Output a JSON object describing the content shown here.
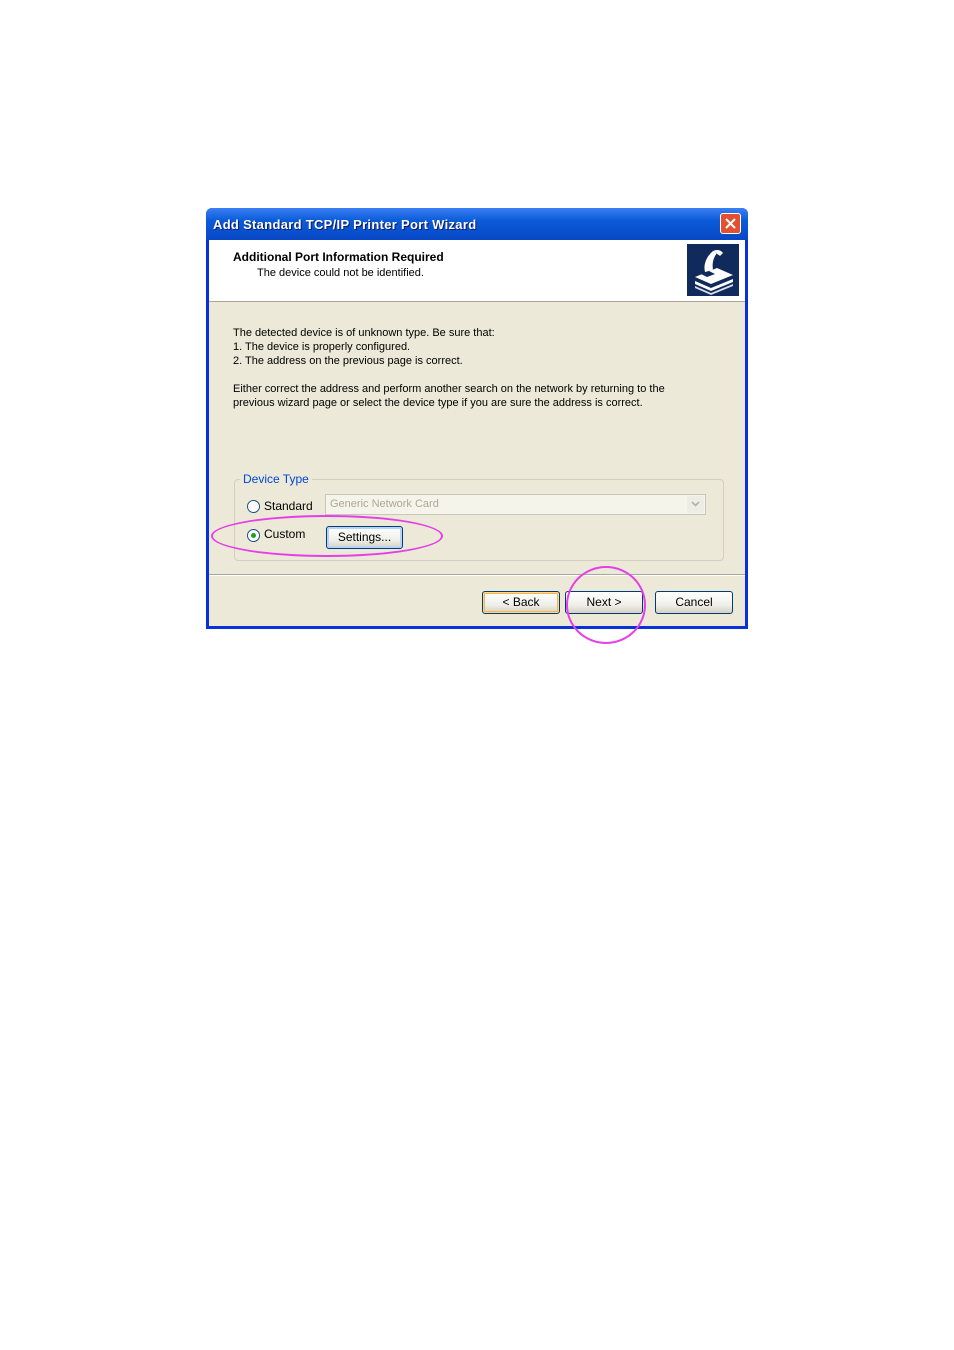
{
  "window": {
    "title": "Add Standard TCP/IP Printer Port Wizard"
  },
  "header": {
    "title": "Additional Port Information Required",
    "subtitle": "The device could not be identified."
  },
  "body": {
    "lines": [
      "The detected device is of unknown type.  Be sure that:",
      "1. The device is properly configured.",
      "2.  The address on the previous page is correct."
    ],
    "paragraph": [
      "Either correct the address and perform another search on the network by returning to the",
      "previous wizard page or select the device type if you are sure the address is correct."
    ]
  },
  "device_type": {
    "legend": "Device Type",
    "standard_label": "Standard",
    "custom_label": "Custom",
    "selected": "Custom",
    "combo_value": "Generic Network Card",
    "settings_button": "Settings..."
  },
  "footer": {
    "back_button": "< Back",
    "next_button": "Next >",
    "cancel_button": "Cancel"
  },
  "colors": {
    "annotation": "#e53fe6",
    "titlebar": "#0a5bd8",
    "group_legend": "#0046d5"
  },
  "icons": [
    "close-icon",
    "printer-wizard-icon",
    "chevron-down-icon"
  ]
}
